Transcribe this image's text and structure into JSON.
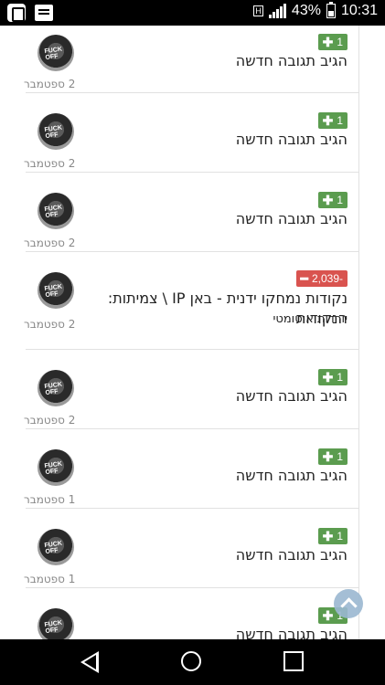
{
  "status_bar": {
    "battery": "43%",
    "time": "10:31",
    "network_label": "H"
  },
  "avatar_caption": "FUCK OFF",
  "items": [
    {
      "badge": "1",
      "type": "plus",
      "title": "הגיב תגובה חדשה",
      "date": "2 ספטמבר"
    },
    {
      "badge": "1",
      "type": "plus",
      "title": "הגיב תגובה חדשה",
      "date": "2 ספטמבר"
    },
    {
      "badge": "1",
      "type": "plus",
      "title": "הגיב תגובה חדשה",
      "date": "2 ספטמבר"
    },
    {
      "badge": "2,039-",
      "type": "minus",
      "title": "נקודות נמחקו ידנית - באן IP \\ צמיתות: הנקודות",
      "title2": "יורדות אוטומטי",
      "date": "2 ספטמבר"
    },
    {
      "badge": "1",
      "type": "plus",
      "title": "הגיב תגובה חדשה",
      "date": "2 ספטמבר"
    },
    {
      "badge": "1",
      "type": "plus",
      "title": "הגיב תגובה חדשה",
      "date": "1 ספטמבר"
    },
    {
      "badge": "1",
      "type": "plus",
      "title": "הגיב תגובה חדשה",
      "date": "1 ספטמבר"
    },
    {
      "badge": "1",
      "type": "plus",
      "title": "הגיב תגובה חדשה",
      "date": ""
    }
  ],
  "colors": {
    "plus_badge": "#5b9c4f",
    "minus_badge": "#d9534f",
    "scroll_top": "#9bb8d1"
  }
}
